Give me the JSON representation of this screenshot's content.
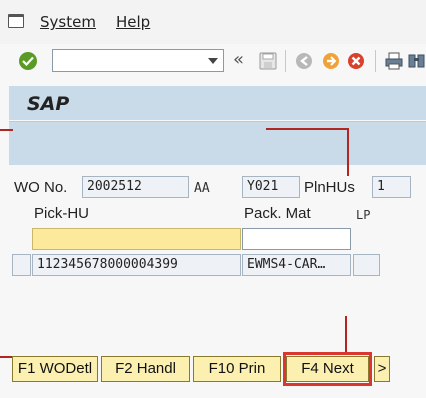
{
  "menu": {
    "system": "System",
    "help": "Help"
  },
  "toolbar": {
    "command_value": "",
    "nav_arrow": "«",
    "icons": [
      "ok-icon",
      "save-icon",
      "back-icon",
      "exit-icon",
      "cancel-icon",
      "print-icon",
      "find-icon"
    ]
  },
  "screen": {
    "title": "SAP",
    "wo_label": "WO No.",
    "wo_value": "2002512",
    "wo_type": "AA",
    "wo_code": "Y021",
    "plnhus_label": "PlnHUs",
    "plnhus_value": "1",
    "pick_hu_label": "Pick-HU",
    "pack_mat_label": "Pack. Mat",
    "lp_label": "LP",
    "pick_hu_input": "",
    "pack_mat_input": "",
    "row": {
      "hu": "112345678000004399",
      "material": "EWMS4-CAR…",
      "lp": ""
    }
  },
  "fkeys": {
    "f1": "F1 WODetl",
    "f2": "F2 Handl",
    "f10": "F10 Prin",
    "f4": "F4 Next",
    "more": ">"
  },
  "colors": {
    "title_bar": "#c9dbe9",
    "fkey_bg": "#fbf0b0",
    "highlight": "#d9372f",
    "input_yellow": "#fde99c"
  }
}
